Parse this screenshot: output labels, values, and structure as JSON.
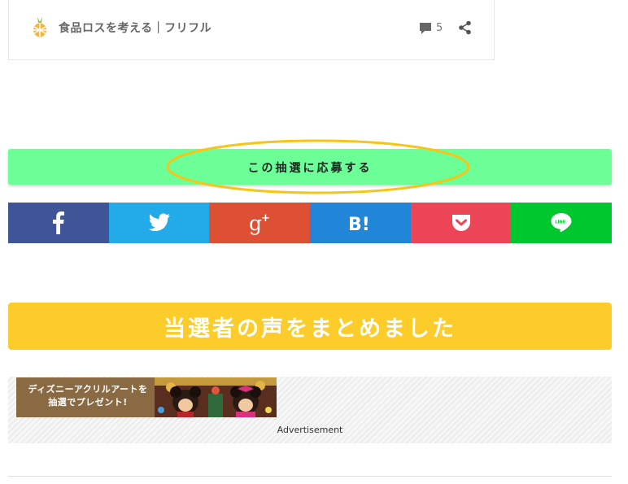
{
  "card": {
    "site_name": "食品ロスを考える｜フリフル",
    "comment_count": "5"
  },
  "apply_button": {
    "label": "この抽選に応募する"
  },
  "share_buttons": [
    {
      "network": "facebook",
      "color": "#3b5998"
    },
    {
      "network": "twitter",
      "color": "#1da1f2"
    },
    {
      "network": "google-plus",
      "color": "#dd4b39"
    },
    {
      "network": "hatena-bookmark",
      "color": "#2c89dd"
    },
    {
      "network": "pocket",
      "color": "#ef4056"
    },
    {
      "network": "line",
      "color": "#00c300"
    }
  ],
  "section": {
    "heading": "当選者の声をまとめました"
  },
  "ad": {
    "banner_line1": "ディズニーアクリルアートを",
    "banner_line2": "抽選でプレゼント!",
    "caption": "Advertisement"
  },
  "colors": {
    "apply_bg": "#6cff98",
    "highlight_ring": "#f5c518",
    "heading_bg": "#fccd2a"
  }
}
